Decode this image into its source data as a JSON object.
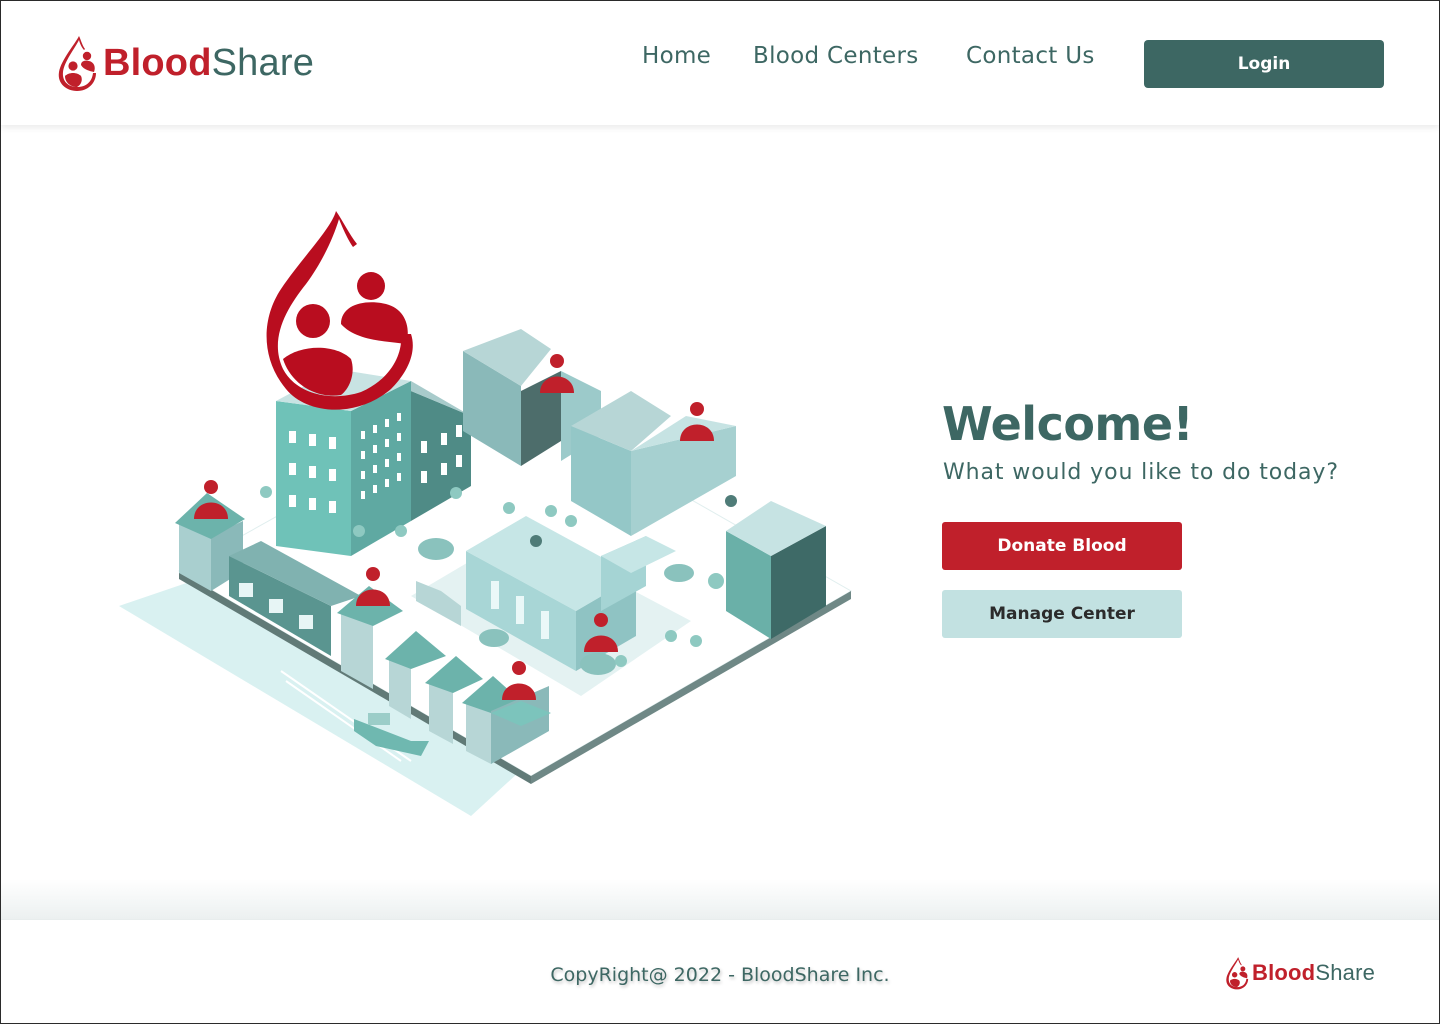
{
  "brand": {
    "name_part1": "Blood",
    "name_part2": "Share",
    "logo_icon": "blood-drop-people-icon",
    "colors": {
      "primary_red": "#c0202b",
      "primary_teal": "#3d6763",
      "light_teal": "#c2e1e1"
    }
  },
  "header": {
    "nav": [
      {
        "label": "Home"
      },
      {
        "label": "Blood Centers"
      },
      {
        "label": "Contact Us"
      }
    ],
    "login_label": "Login"
  },
  "hero": {
    "illustration": "isometric-city-blood-donors-illustration",
    "title": "Welcome!",
    "subtitle": "What would you like to do today?",
    "actions": [
      {
        "label": "Donate Blood"
      },
      {
        "label": "Manage Center"
      }
    ]
  },
  "footer": {
    "copyright": "CopyRight@ 2022 - BloodShare Inc."
  }
}
